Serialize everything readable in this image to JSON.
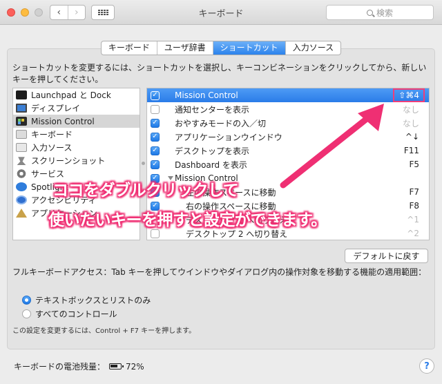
{
  "window": {
    "title": "キーボード",
    "search_placeholder": "検索",
    "nav_back": "‹",
    "nav_forward": "›"
  },
  "tabs": [
    {
      "label": "キーボード",
      "active": false
    },
    {
      "label": "ユーザ辞書",
      "active": false
    },
    {
      "label": "ショートカット",
      "active": true
    },
    {
      "label": "入力ソース",
      "active": false
    }
  ],
  "instructions": "ショートカットを変更するには、ショートカットを選択し、キーコンビネーションをクリックしてから、新しいキーを押してください。",
  "categories": [
    {
      "label": "Launchpad と Dock",
      "icon": "launchpad-icon"
    },
    {
      "label": "ディスプレイ",
      "icon": "display-icon"
    },
    {
      "label": "Mission Control",
      "icon": "mission-control-icon",
      "selected": true
    },
    {
      "label": "キーボード",
      "icon": "keyboard-icon"
    },
    {
      "label": "入力ソース",
      "icon": "input-source-icon"
    },
    {
      "label": "スクリーンショット",
      "icon": "screenshot-icon"
    },
    {
      "label": "サービス",
      "icon": "services-gear-icon"
    },
    {
      "label": "Spotlight",
      "icon": "spotlight-icon"
    },
    {
      "label": "アクセシビリティ",
      "icon": "accessibility-icon"
    },
    {
      "label": "アプリケーション",
      "icon": "app-shortcuts-icon"
    }
  ],
  "shortcuts": [
    {
      "label": "Mission Control",
      "key": "⇧⌘4",
      "checked": true,
      "selected": true,
      "indent": 0
    },
    {
      "label": "通知センターを表示",
      "key": "なし",
      "checked": false,
      "dim": true,
      "indent": 0
    },
    {
      "label": "おやすみモードの入／切",
      "key": "なし",
      "checked": true,
      "dim": true,
      "indent": 0
    },
    {
      "label": "アプリケーションウインドウ",
      "key": "^↓",
      "checked": true,
      "indent": 0
    },
    {
      "label": "デスクトップを表示",
      "key": "F11",
      "checked": true,
      "indent": 0
    },
    {
      "label": "Dashboard を表示",
      "key": "F5",
      "checked": true,
      "indent": 0
    },
    {
      "label": "Mission Control",
      "key": "",
      "checked": true,
      "indent": 1,
      "group": true
    },
    {
      "label": "左の操作スペースに移動",
      "key": "F7",
      "checked": true,
      "indent": 2
    },
    {
      "label": "右の操作スペースに移動",
      "key": "F8",
      "checked": true,
      "indent": 2
    },
    {
      "label": "デスクトップ 1 へ切り替え",
      "key": "^1",
      "checked": false,
      "dim": true,
      "indent": 2
    },
    {
      "label": "デスクトップ 2 へ切り替え",
      "key": "^2",
      "checked": false,
      "dim": true,
      "indent": 2
    }
  ],
  "annotation": {
    "line1": "ココをダブルクリックして",
    "line2": "使いたいキーを押すと設定ができます。"
  },
  "defaults_button": "デフォルトに戻す",
  "full_keyboard_access": "フルキーボードアクセス：Tab キーを押してウインドウやダイアログ内の操作対象を移動する機能の適用範囲：",
  "radio_options": [
    {
      "label": "テキストボックスとリストのみ",
      "selected": true
    },
    {
      "label": "すべてのコントロール",
      "selected": false
    }
  ],
  "hint": "この設定を変更するには、Control + F7 キーを押します。",
  "battery": {
    "label": "キーボードの電池残量：",
    "value": "72%"
  },
  "help_label": "?",
  "colors": {
    "accent": "#2a7ce8",
    "annotation": "#ef2f73"
  }
}
